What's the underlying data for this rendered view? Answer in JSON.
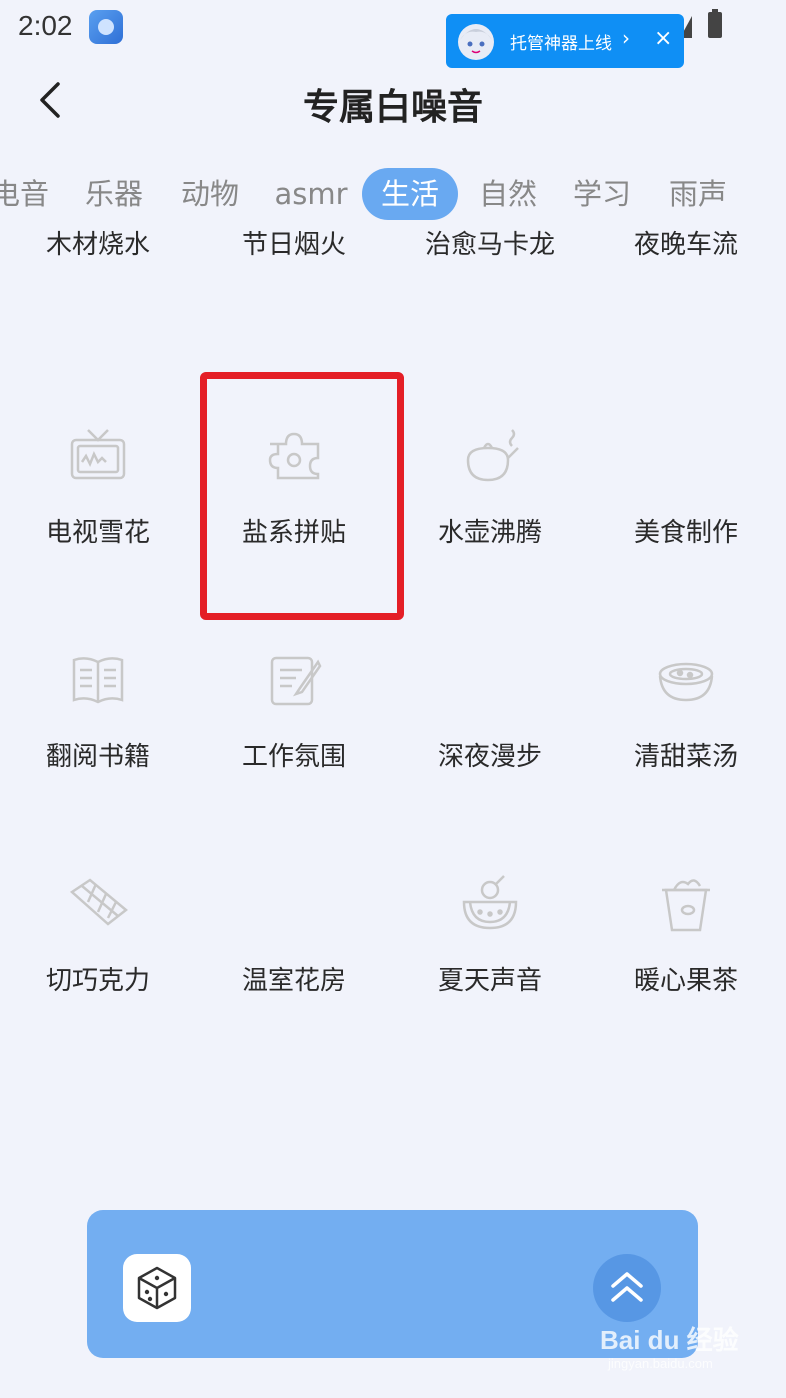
{
  "status_bar": {
    "time": "2:02"
  },
  "promo": {
    "text": "托管神器上线",
    "chevron": "›",
    "close": "×"
  },
  "header": {
    "title": "专属白噪音"
  },
  "tabs": [
    {
      "label": "电音",
      "active": false
    },
    {
      "label": "乐器",
      "active": false
    },
    {
      "label": "动物",
      "active": false
    },
    {
      "label": "asmr",
      "active": false
    },
    {
      "label": "生活",
      "active": true
    },
    {
      "label": "自然",
      "active": false
    },
    {
      "label": "学习",
      "active": false
    },
    {
      "label": "雨声",
      "active": false
    }
  ],
  "sounds": [
    {
      "label": "木材烧水",
      "icon": "firewood-icon"
    },
    {
      "label": "节日烟火",
      "icon": "fireworks-icon"
    },
    {
      "label": "治愈马卡龙",
      "icon": "macaron-icon"
    },
    {
      "label": "夜晚车流",
      "icon": "car-icon"
    },
    {
      "label": "电视雪花",
      "icon": "tv-icon"
    },
    {
      "label": "盐系拼贴",
      "icon": "puzzle-icon"
    },
    {
      "label": "水壶沸腾",
      "icon": "kettle-icon"
    },
    {
      "label": "美食制作",
      "icon": "cooking-icon"
    },
    {
      "label": "翻阅书籍",
      "icon": "book-icon"
    },
    {
      "label": "工作氛围",
      "icon": "notepad-icon"
    },
    {
      "label": "深夜漫步",
      "icon": "walk-icon"
    },
    {
      "label": "清甜菜汤",
      "icon": "soup-icon"
    },
    {
      "label": "切巧克力",
      "icon": "chocolate-icon"
    },
    {
      "label": "温室花房",
      "icon": "flower-icon"
    },
    {
      "label": "夏天声音",
      "icon": "watermelon-icon"
    },
    {
      "label": "暖心果茶",
      "icon": "fruit-tea-icon"
    }
  ],
  "highlight": {
    "target": "盐系拼贴",
    "color": "#e41e26"
  },
  "player": {
    "color": "#73aef1"
  },
  "watermark": {
    "logo": "Bai du 经验",
    "sub": "jingyan.baidu.com"
  }
}
